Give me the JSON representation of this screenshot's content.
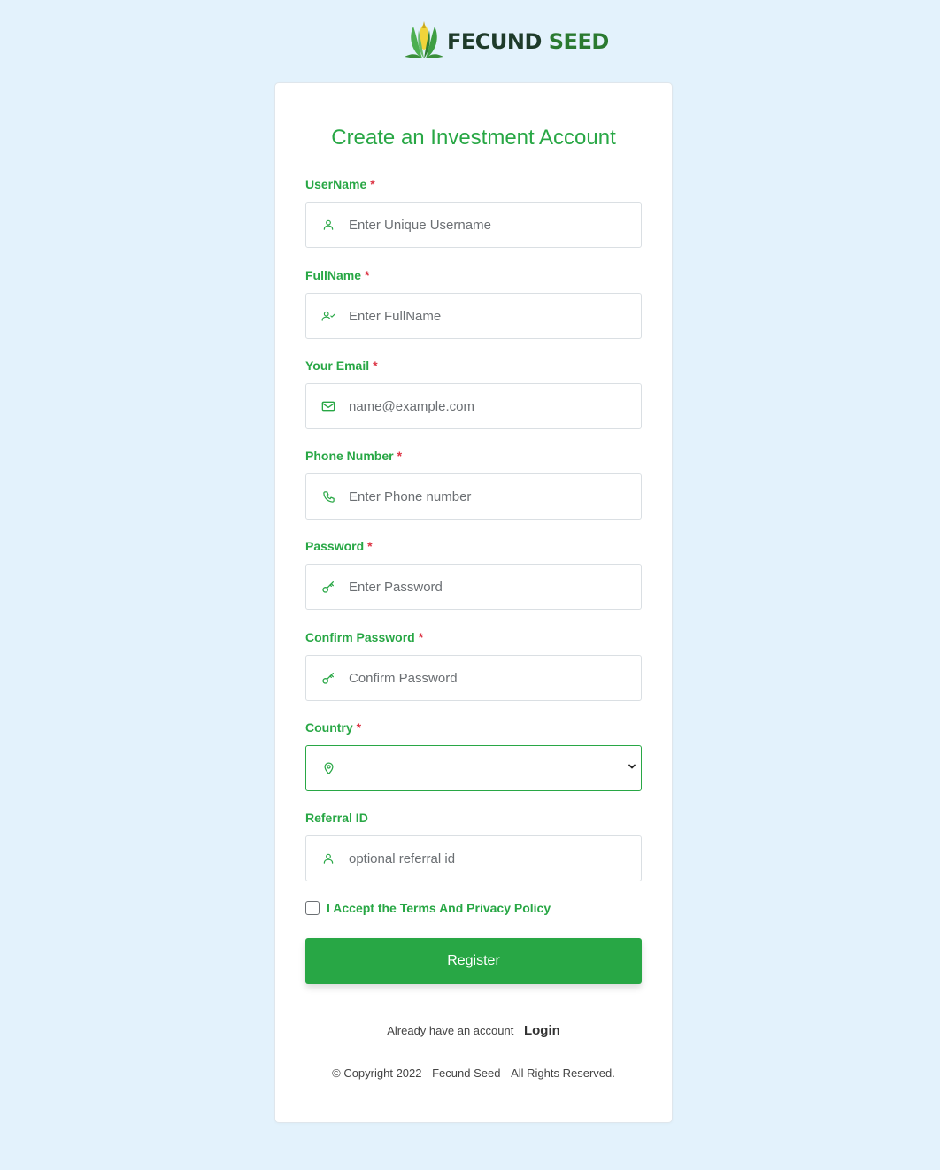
{
  "brand": {
    "word1": "FECUND",
    "word2": "SEED"
  },
  "form": {
    "title": "Create an Investment Account",
    "required_mark": "*",
    "fields": {
      "username": {
        "label": "UserName",
        "placeholder": "Enter Unique Username",
        "icon": "user-icon"
      },
      "fullname": {
        "label": "FullName",
        "placeholder": "Enter FullName",
        "icon": "user-check-icon"
      },
      "email": {
        "label": "Your Email",
        "placeholder": "name@example.com",
        "icon": "mail-icon"
      },
      "phone": {
        "label": "Phone Number",
        "placeholder": "Enter Phone number",
        "icon": "phone-icon"
      },
      "password": {
        "label": "Password",
        "placeholder": "Enter Password",
        "icon": "key-icon"
      },
      "confirm_password": {
        "label": "Confirm Password",
        "placeholder": "Confirm Password",
        "icon": "key-icon"
      },
      "country": {
        "label": "Country",
        "icon": "map-pin-icon"
      },
      "referral": {
        "label": "Referral ID",
        "placeholder": "optional referral id",
        "icon": "user-icon"
      }
    },
    "terms_label": "I Accept the Terms And Privacy Policy",
    "register_label": "Register"
  },
  "footer": {
    "already_text": "Already have an account",
    "login_label": "Login",
    "copyright": "© Copyright 2022",
    "company": "Fecund Seed",
    "rights": "All Rights Reserved."
  },
  "colors": {
    "accent": "#28a745",
    "background": "#e3f2fc",
    "required": "#dc3545"
  }
}
